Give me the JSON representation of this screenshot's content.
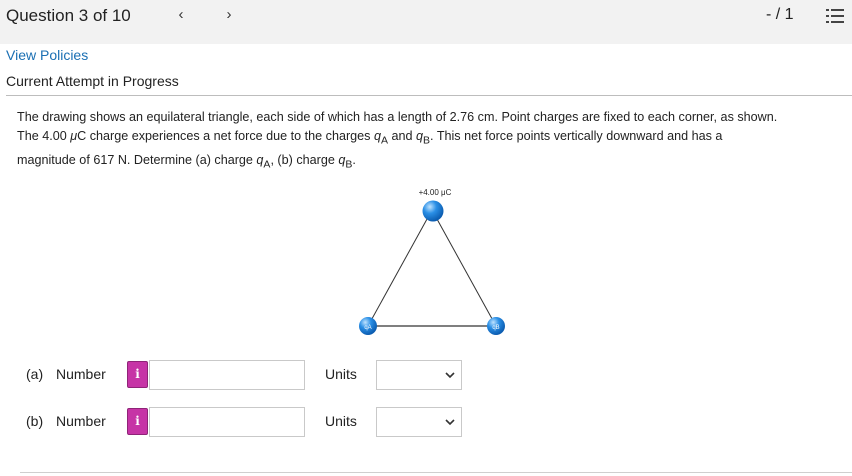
{
  "header": {
    "question_label": "Question 3 of 10",
    "prev_glyph": "‹",
    "next_glyph": "›",
    "score": "- / 1",
    "list_icon": "list-icon"
  },
  "links": {
    "view_policies": "View Policies"
  },
  "attempt_label": "Current Attempt in Progress",
  "problem": {
    "line1": "The drawing shows an equilateral triangle, each side of which has a length of 2.76 cm. Point charges are fixed to each corner, as shown.",
    "line2_a": "The 4.00 ",
    "line2_mu": "μ",
    "line2_b": "C charge experiences a net force due to the charges ",
    "qA": "q",
    "qA_sub": "A",
    "line2_c": " and ",
    "qB": "q",
    "qB_sub": "B",
    "line2_d": ". This net force points vertically downward and has a",
    "line3_a": "magnitude of 617 N. Determine (a) charge ",
    "line3_qA": "q",
    "line3_qA_sub": "A",
    "line3_b": ", (b) charge ",
    "line3_qB": "q",
    "line3_qB_sub": "B",
    "line3_c": "."
  },
  "diagram": {
    "top_charge_label": "+4.00 μC",
    "left_charge_label": "qA",
    "right_charge_label": "qB",
    "charge_color": "#2a8fe6"
  },
  "answers": [
    {
      "part": "(a)",
      "label": "Number",
      "info": "i",
      "value": "",
      "units_label": "Units",
      "units_value": ""
    },
    {
      "part": "(b)",
      "label": "Number",
      "info": "i",
      "value": "",
      "units_label": "Units",
      "units_value": ""
    }
  ],
  "colors": {
    "info_button": "#c634a6",
    "link": "#1a6fb3",
    "topbar": "#f2f2f2"
  }
}
